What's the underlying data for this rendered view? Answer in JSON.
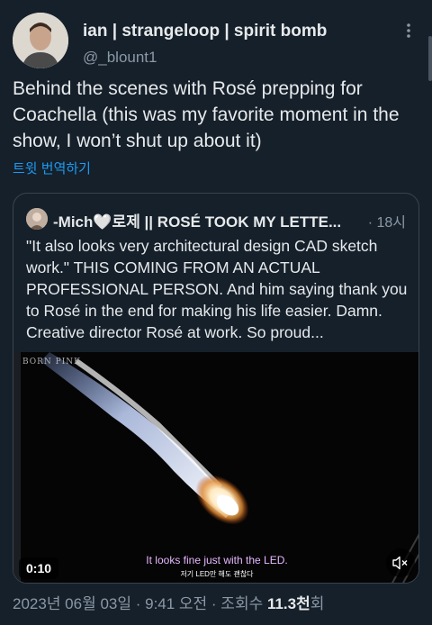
{
  "author": {
    "name": "ian | strangeloop | spirit bomb",
    "handle": "@_blount1"
  },
  "tweet": {
    "text": "Behind the scenes with Rosé prepping for Coachella (this was my favorite moment in the show, I won’t shut up about it)",
    "translate_label": "트윗 번역하기"
  },
  "quote": {
    "author_name": "-Mich🤍로제 || ROSÉ TOOK MY LETTE...",
    "time": "· 18시",
    "text": "\"It also looks very architectural design CAD sketch work.\" THIS COMING FROM AN ACTUAL PROFESSIONAL PERSON. And him saying thank you to Rosé in the end for making his life easier. Damn. Creative director Rosé at work. So proud..."
  },
  "video": {
    "watermark": "BORN PINK",
    "duration": "0:10",
    "subtitle_en": "It looks fine just with the LED.",
    "subtitle_ko": "저기 LED만 해도 괜찮다"
  },
  "footer": {
    "datetime": "2023년 06월 03일 · 9:41 오전 · 조회수 ",
    "views": "11.3천",
    "views_suffix": "회"
  },
  "colors": {
    "background": "#15202b",
    "link": "#1d9bf0",
    "secondary_text": "#8b98a5"
  }
}
